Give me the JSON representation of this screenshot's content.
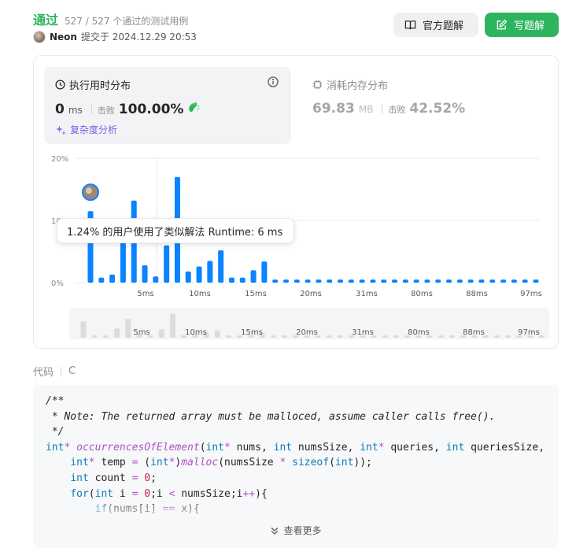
{
  "header": {
    "status": "通过",
    "passed_text": "527 / 527 个通过的测试用例",
    "user": "Neon",
    "submitted_text": "提交于 2024.12.29 20:53",
    "official_button": "官方题解",
    "write_button": "写题解"
  },
  "runtime": {
    "title": "执行用时分布",
    "value": "0",
    "unit": "ms",
    "beat_label": "击败",
    "beat_value": "100.00%",
    "complexity_link": "复杂度分析"
  },
  "memory": {
    "title": "消耗内存分布",
    "value": "69.83",
    "unit": "MB",
    "beat_label": "击败",
    "beat_value": "42.52%"
  },
  "tooltip": "1.24% 的用户使用了类似解法 Runtime: 6 ms",
  "chart_data": {
    "type": "bar",
    "y_ticks": [
      "20%",
      "10%",
      "0%"
    ],
    "x_ticks": [
      "5ms",
      "10ms",
      "15ms",
      "20ms",
      "31ms",
      "80ms",
      "88ms",
      "97ms"
    ],
    "values": [
      11.5,
      0.8,
      1.3,
      6.5,
      13.2,
      2.8,
      1.0,
      6.0,
      17.0,
      1.8,
      2.6,
      3.5,
      5.2,
      0.8,
      0.8,
      2.0,
      3.4,
      0.5,
      0.5,
      0.5,
      0.5,
      0.5,
      0.5,
      0.5,
      0.5,
      0.5,
      0.5,
      0.5,
      0.5,
      0.5,
      0.5,
      0.5,
      0.5,
      0.5,
      0.5,
      0.5,
      0.5,
      0.5,
      0.5,
      0.5,
      0.5,
      0.5
    ],
    "ylim": [
      0,
      20
    ],
    "bar_color": "#0a84ff"
  },
  "code": {
    "label": "代码",
    "language": "C",
    "more": "查看更多",
    "lines": [
      [
        [
          "c-com",
          "/**"
        ]
      ],
      [
        [
          "c-com",
          " * Note: The returned array must be malloced, assume caller calls free()."
        ]
      ],
      [
        [
          "c-com",
          " */"
        ]
      ],
      [
        [
          "c-kw",
          "int"
        ],
        [
          "c-op",
          "*"
        ],
        [
          "",
          " "
        ],
        [
          "c-fn",
          "occurrencesOfElement"
        ],
        [
          "",
          "("
        ],
        [
          "c-kw",
          "int"
        ],
        [
          "c-op",
          "*"
        ],
        [
          "",
          " nums, "
        ],
        [
          "c-kw",
          "int"
        ],
        [
          "",
          " numsSize, "
        ],
        [
          "c-kw",
          "int"
        ],
        [
          "c-op",
          "*"
        ],
        [
          "",
          " queries, "
        ],
        [
          "c-kw",
          "int"
        ],
        [
          "",
          " queriesSize,"
        ]
      ],
      [
        [
          "",
          "    "
        ],
        [
          "c-kw",
          "int"
        ],
        [
          "c-op",
          "*"
        ],
        [
          "",
          " temp "
        ],
        [
          "c-op",
          "="
        ],
        [
          "",
          " ("
        ],
        [
          "c-kw",
          "int"
        ],
        [
          "c-op",
          "*"
        ],
        [
          "",
          ")"
        ],
        [
          "c-fn",
          "malloc"
        ],
        [
          "",
          "(numsSize "
        ],
        [
          "c-op",
          "*"
        ],
        [
          "",
          " "
        ],
        [
          "c-kw",
          "sizeof"
        ],
        [
          "",
          "("
        ],
        [
          "c-kw",
          "int"
        ],
        [
          "",
          "));"
        ]
      ],
      [
        [
          "",
          "    "
        ],
        [
          "c-kw",
          "int"
        ],
        [
          "",
          " count "
        ],
        [
          "c-op",
          "="
        ],
        [
          "",
          " "
        ],
        [
          "c-num",
          "0"
        ],
        [
          "",
          ";"
        ]
      ],
      [
        [
          "",
          "    "
        ],
        [
          "c-kw",
          "for"
        ],
        [
          "",
          "("
        ],
        [
          "c-kw",
          "int"
        ],
        [
          "",
          " i "
        ],
        [
          "c-op",
          "="
        ],
        [
          "",
          " "
        ],
        [
          "c-num",
          "0"
        ],
        [
          "",
          ";i "
        ],
        [
          "c-op",
          "<"
        ],
        [
          "",
          " numsSize;i"
        ],
        [
          "c-op",
          "++"
        ],
        [
          "",
          "){"
        ]
      ],
      [
        [
          "",
          "        "
        ],
        [
          "c-kw",
          "if"
        ],
        [
          "",
          "(nums[i] "
        ],
        [
          "c-op",
          "=="
        ],
        [
          "",
          " x){"
        ]
      ]
    ]
  }
}
